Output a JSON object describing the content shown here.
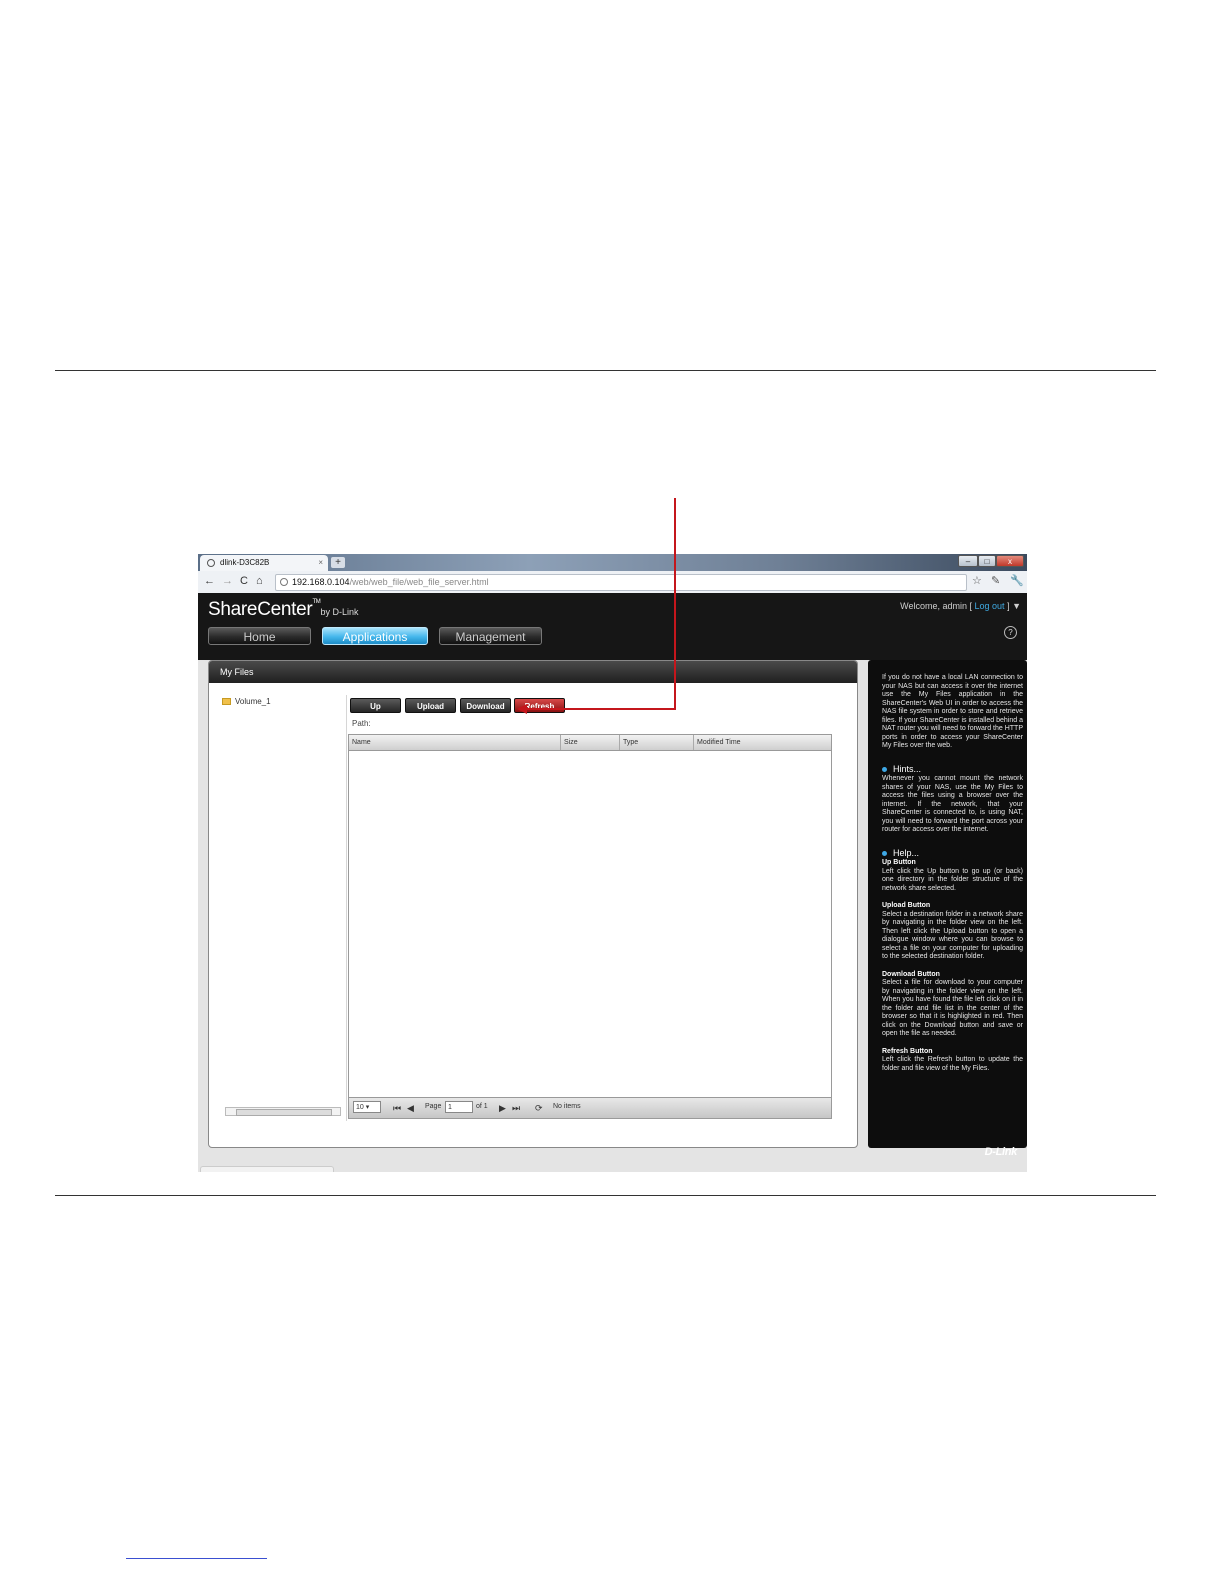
{
  "browser": {
    "tab_title": "dlink-D3C82B",
    "new_tab": "+",
    "close_tab": "×",
    "url_host": "192.168.0.104",
    "url_path": "/web/web_file/web_file_server.html"
  },
  "app": {
    "logo": "ShareCenter",
    "logo_tm": "TM",
    "logo_by": "by D-Link",
    "welcome": "Welcome, admin [",
    "logout": "Log out",
    "welcome_end": "] ▼",
    "nav": [
      {
        "label": "Home",
        "active": false
      },
      {
        "label": "Applications",
        "active": true
      },
      {
        "label": "Management",
        "active": false
      }
    ]
  },
  "panel": {
    "title": "My Files",
    "tree_item": "Volume_1",
    "toolbar": {
      "up": "Up",
      "upload": "Upload",
      "download": "Download",
      "refresh": "Refresh"
    },
    "path_label": "Path:",
    "columns": [
      "Name",
      "Size",
      "Type",
      "Modified Time"
    ],
    "page_size": "10",
    "page_label": "Page",
    "page_value": "1",
    "page_of": "of 1",
    "status": "No items"
  },
  "help": {
    "intro": "If you do not have a local LAN connection to your NAS but can access it over the internet use the My Files application in the ShareCenter's Web UI in order to access the NAS file system in order to store and retrieve files. If your ShareCenter is installed behind a NAT router you will need to forward the HTTP ports in order to access your ShareCenter My Files over the web.",
    "hints_title": "Hints...",
    "hints": "Whenever you cannot mount the network shares of your NAS, use the My Files to access the files using a browser over the internet. If the network, that your ShareCenter is connected to, is using NAT, you will need to forward the port across your router for access over the internet.",
    "help_title": "Help...",
    "up_title": "Up Button",
    "up_text": "Left click the Up button to go up (or back) one directory in the folder structure of the network share selected.",
    "upload_title": "Upload Button",
    "upload_text": "Select a destination folder in a network share by navigating in the folder view on the left. Then left click the Upload button to open a dialogue window where you can browse to select a file on your computer for uploading to the selected destination folder.",
    "download_title": "Download Button",
    "download_text": "Select a file for download to your computer by navigating in the folder view on the left. When you have found the file left click on it in the folder and file list in the center of the browser so that it is highlighted in red. Then click on the Download button and save or open the file as needed.",
    "refresh_title": "Refresh Button",
    "refresh_text": "Left click the Refresh button to update the folder and file view of the My Files.",
    "brand": "D-Link"
  },
  "colors": {
    "accent": "#44b7ec",
    "annotation": "#c4161c",
    "header": "#161616"
  }
}
